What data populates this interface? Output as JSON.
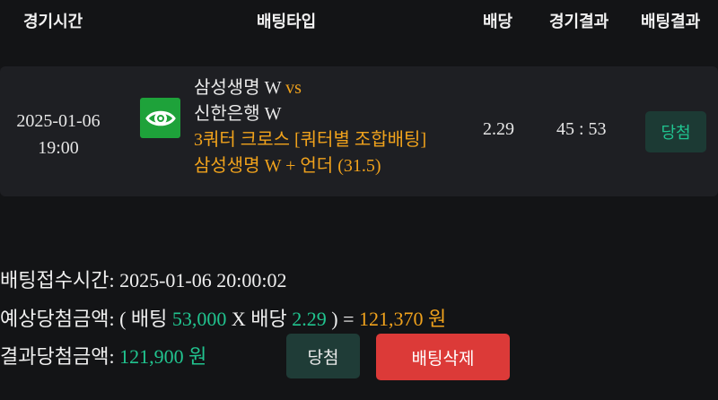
{
  "header": {
    "time": "경기시간",
    "type": "배팅타입",
    "odds": "배당",
    "game_result": "경기결과",
    "bet_result": "배팅결과"
  },
  "bet": {
    "date": "2025-01-06",
    "time": "19:00",
    "home_team": "삼성생명 W",
    "vs": "vs",
    "away_team": "신한은행 W",
    "market": "3쿼터 크로스 [쿼터별 조합배팅]",
    "selection": "삼성생명 W + 언더 (31.5)",
    "odds": "2.29",
    "score": "45 : 53",
    "result": "당첨",
    "icon": "eye-icon"
  },
  "summary": {
    "received_label": "배팅접수시간:",
    "received_value": "2025-01-06 20:00:02",
    "expected_label": "예상당첨금액:",
    "open_paren": "(",
    "bet_label": "배팅",
    "bet_amount": "53,000",
    "times": "X",
    "odds_label": "배당",
    "odds_value": "2.29",
    "close_eq": ") =",
    "expected_amount": "121,370 원",
    "actual_label": "결과당첨금액:",
    "actual_amount": "121,900 원",
    "win_button": "당첨",
    "delete_button": "배팅삭제"
  },
  "colors": {
    "accent_green": "#21c48f",
    "accent_orange": "#f0a21c",
    "delete_red": "#dc3a38"
  }
}
